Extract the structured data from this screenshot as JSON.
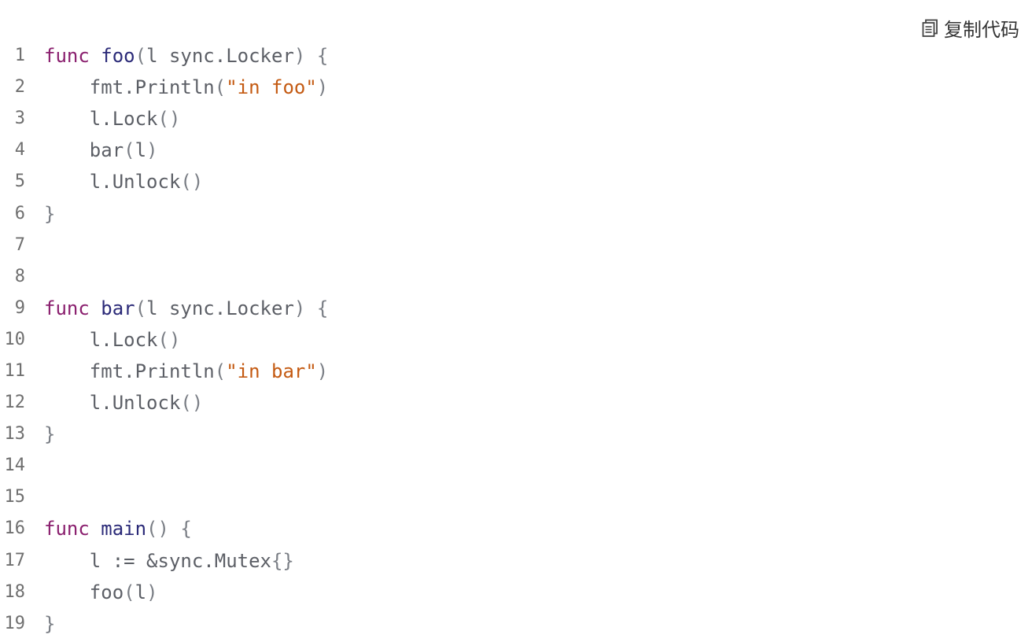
{
  "toolbar": {
    "copy_label": "复制代码",
    "copy_icon": "copy-icon"
  },
  "code": {
    "language": "go",
    "lines": [
      {
        "n": "1",
        "tokens": [
          [
            "kw",
            "func"
          ],
          [
            "plain",
            " "
          ],
          [
            "fn",
            "foo"
          ],
          [
            "punc",
            "("
          ],
          [
            "plain",
            "l sync.Locker"
          ],
          [
            "punc",
            ")"
          ],
          [
            "plain",
            " "
          ],
          [
            "punc",
            "{"
          ]
        ]
      },
      {
        "n": "2",
        "tokens": [
          [
            "plain",
            "    fmt.Println"
          ],
          [
            "punc",
            "("
          ],
          [
            "str",
            "\"in foo\""
          ],
          [
            "punc",
            ")"
          ]
        ]
      },
      {
        "n": "3",
        "tokens": [
          [
            "plain",
            "    l.Lock"
          ],
          [
            "punc",
            "()"
          ]
        ]
      },
      {
        "n": "4",
        "tokens": [
          [
            "plain",
            "    bar"
          ],
          [
            "punc",
            "("
          ],
          [
            "plain",
            "l"
          ],
          [
            "punc",
            ")"
          ]
        ]
      },
      {
        "n": "5",
        "tokens": [
          [
            "plain",
            "    l.Unlock"
          ],
          [
            "punc",
            "()"
          ]
        ]
      },
      {
        "n": "6",
        "tokens": [
          [
            "punc",
            "}"
          ]
        ]
      },
      {
        "n": "7",
        "tokens": []
      },
      {
        "n": "8",
        "tokens": []
      },
      {
        "n": "9",
        "tokens": [
          [
            "kw",
            "func"
          ],
          [
            "plain",
            " "
          ],
          [
            "fn",
            "bar"
          ],
          [
            "punc",
            "("
          ],
          [
            "plain",
            "l sync.Locker"
          ],
          [
            "punc",
            ")"
          ],
          [
            "plain",
            " "
          ],
          [
            "punc",
            "{"
          ]
        ]
      },
      {
        "n": "10",
        "tokens": [
          [
            "plain",
            "    l.Lock"
          ],
          [
            "punc",
            "()"
          ]
        ]
      },
      {
        "n": "11",
        "tokens": [
          [
            "plain",
            "    fmt.Println"
          ],
          [
            "punc",
            "("
          ],
          [
            "str",
            "\"in bar\""
          ],
          [
            "punc",
            ")"
          ]
        ]
      },
      {
        "n": "12",
        "tokens": [
          [
            "plain",
            "    l.Unlock"
          ],
          [
            "punc",
            "()"
          ]
        ]
      },
      {
        "n": "13",
        "tokens": [
          [
            "punc",
            "}"
          ]
        ]
      },
      {
        "n": "14",
        "tokens": []
      },
      {
        "n": "15",
        "tokens": []
      },
      {
        "n": "16",
        "tokens": [
          [
            "kw",
            "func"
          ],
          [
            "plain",
            " "
          ],
          [
            "fn",
            "main"
          ],
          [
            "punc",
            "()"
          ],
          [
            "plain",
            " "
          ],
          [
            "punc",
            "{"
          ]
        ]
      },
      {
        "n": "17",
        "tokens": [
          [
            "plain",
            "    l := &sync.Mutex"
          ],
          [
            "punc",
            "{}"
          ]
        ]
      },
      {
        "n": "18",
        "tokens": [
          [
            "plain",
            "    foo"
          ],
          [
            "punc",
            "("
          ],
          [
            "plain",
            "l"
          ],
          [
            "punc",
            ")"
          ]
        ]
      },
      {
        "n": "19",
        "tokens": [
          [
            "punc",
            "}"
          ]
        ]
      }
    ]
  },
  "colors": {
    "keyword": "#8a1f6e",
    "function": "#2b2a78",
    "string": "#c45a12",
    "plain": "#5c5f66",
    "line_number": "#6f6f6f"
  }
}
